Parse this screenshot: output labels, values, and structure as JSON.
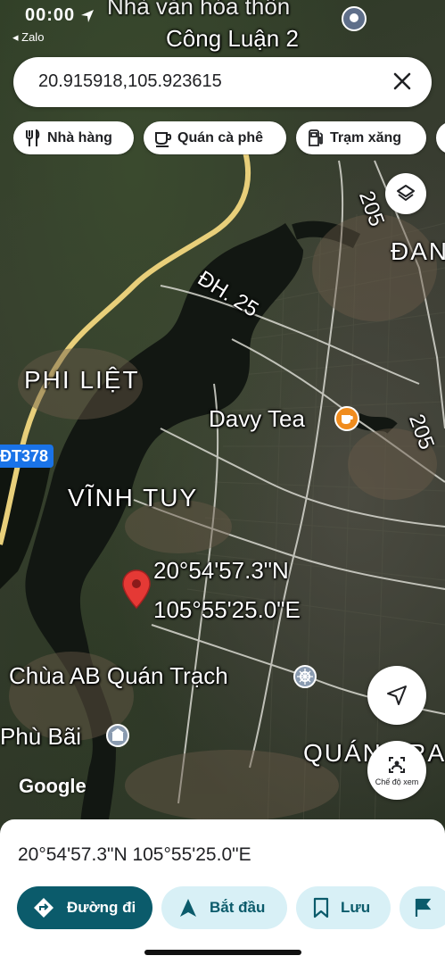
{
  "status": {
    "time": "00:00",
    "back_app": "◂ Zalo"
  },
  "search": {
    "query": "20.915918,105.923615"
  },
  "chips": [
    {
      "label": "Nhà hàng",
      "icon": "restaurant-icon"
    },
    {
      "label": "Quán cà phê",
      "icon": "coffee-icon"
    },
    {
      "label": "Trạm xăng",
      "icon": "gas-station-icon"
    }
  ],
  "map": {
    "labels": {
      "top_place": "Nhà văn hóa thôn",
      "top_place2": "Công Luận 2",
      "road_dh25": "ĐH. 25",
      "road_205a": "205",
      "road_205b": "205",
      "dan": "ĐAN",
      "phi_liet": "PHI LIỆT",
      "davy_tea": "Davy Tea",
      "dt378": "ĐT378",
      "vinh_tuy": "VĨNH TUY",
      "pin_lat": "20°54'57.3\"N",
      "pin_lng": "105°55'25.0\"E",
      "chua": "Chùa AB Quán Trạch",
      "phu_bai": "Phù Bãi",
      "quan_tra": "QUÁN TRA",
      "google": "Google"
    },
    "view_mode_label": "Chế độ xem"
  },
  "sheet": {
    "coords": "20°54'57.3\"N 105°55'25.0\"E",
    "actions": [
      {
        "label": "Đường đi"
      },
      {
        "label": "Bắt đầu"
      },
      {
        "label": "Lưu"
      }
    ]
  },
  "colors": {
    "primary": "#0b5b6b",
    "secondary": "#d8f0f6",
    "pin": "#e53935"
  }
}
